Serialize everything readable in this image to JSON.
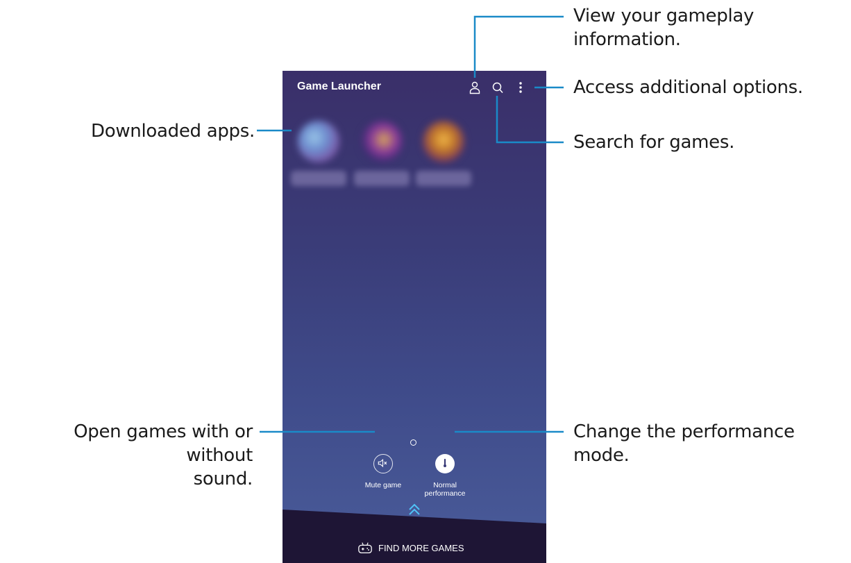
{
  "app": {
    "title": "Game Launcher"
  },
  "top_icons": [
    "profile-icon",
    "search-icon",
    "more-options-icon"
  ],
  "quick_settings": {
    "mute_label": "Mute game",
    "performance_label_line1": "Normal",
    "performance_label_line2": "performance"
  },
  "bottom_bar": {
    "find_more_label": "FIND MORE GAMES"
  },
  "callouts": {
    "gameplay_info_line1": "View your gameplay",
    "gameplay_info_line2": "information.",
    "additional_options": "Access additional options.",
    "downloaded_apps": "Downloaded apps.",
    "search_games": "Search for games.",
    "open_sound_line1": "Open games with or without",
    "open_sound_line2": "sound.",
    "performance_mode": "Change the performance mode."
  },
  "colors": {
    "callout_line": "#1a8ac8",
    "accent_chevron": "#4fc3f7",
    "bottom_bar": "#1e1535"
  }
}
